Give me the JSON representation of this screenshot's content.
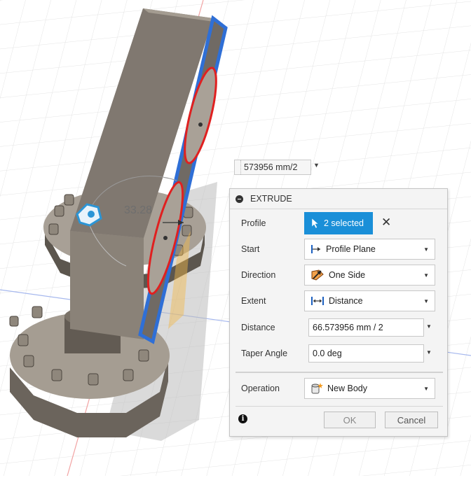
{
  "viewport": {
    "dimension_value": "33.28",
    "distance_input_value": "573956 mm/2",
    "colors": {
      "body": "#7d7468",
      "selected_edge": "#2f6fd6",
      "selected_profile": "#e02020",
      "manipulator": "#2b95d6"
    }
  },
  "dialog": {
    "title": "EXTRUDE",
    "profile": {
      "label": "Profile",
      "selection": "2 selected",
      "icon": "cursor-arrow-icon",
      "clear_icon": "close-icon"
    },
    "start": {
      "label": "Start",
      "value": "Profile Plane",
      "icon": "profile-plane-icon"
    },
    "direction": {
      "label": "Direction",
      "value": "One Side",
      "icon": "one-side-direction-icon"
    },
    "extent": {
      "label": "Extent",
      "value": "Distance",
      "icon": "distance-extent-icon"
    },
    "distance": {
      "label": "Distance",
      "value": "66.573956 mm / 2"
    },
    "taper_angle": {
      "label": "Taper Angle",
      "value": "0.0 deg"
    },
    "operation": {
      "label": "Operation",
      "value": "New Body",
      "icon": "new-body-icon"
    },
    "ok_label": "OK",
    "cancel_label": "Cancel",
    "accent": "#1a8fd8"
  }
}
